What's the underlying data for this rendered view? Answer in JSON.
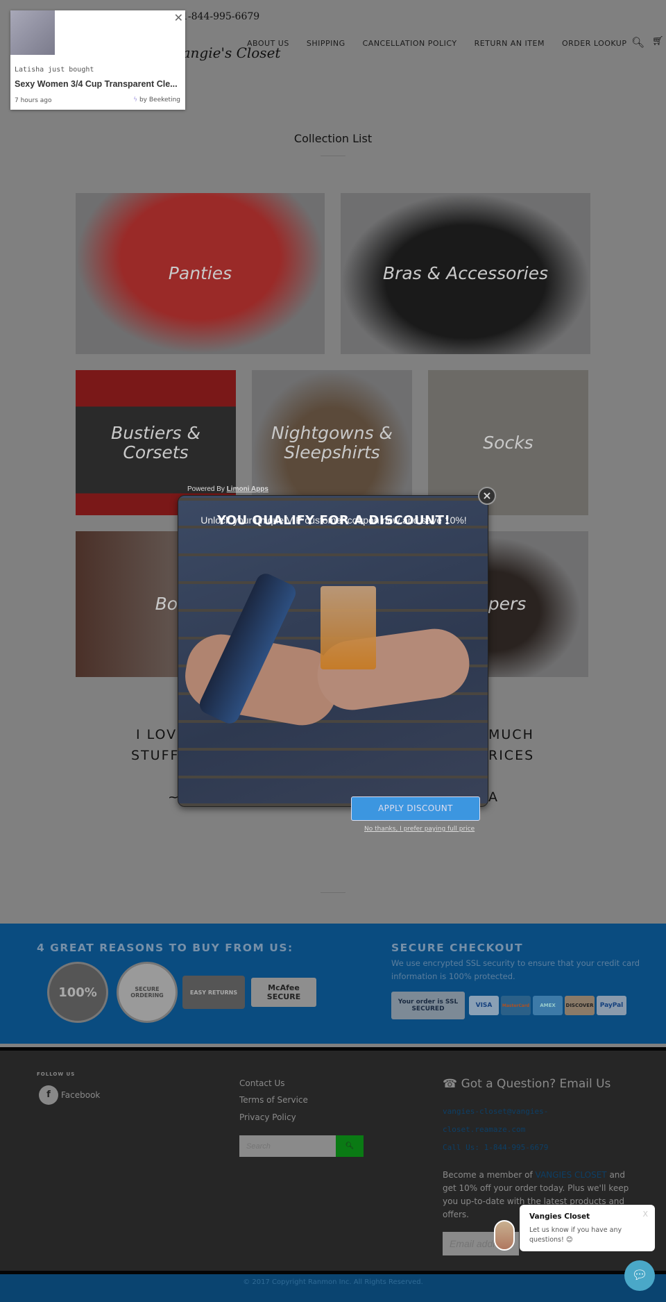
{
  "header": {
    "phone": "1-844-995-6679",
    "logo": "Vangie's Closet",
    "nav": [
      "ABOUT US",
      "SHIPPING",
      "CANCELLATION POLICY",
      "RETURN AN ITEM",
      "ORDER LOOKUP"
    ],
    "icons": [
      "search-icon",
      "cart-icon"
    ]
  },
  "collection": {
    "title": "Collection List",
    "tiles": [
      "Panties",
      "Bras & Accessories",
      "Bustiers & Corsets",
      "Nightgowns & Sleepshirts",
      "Socks",
      "Bodysuits",
      "Rompers"
    ]
  },
  "ticker": {
    "who": "Latisha just bought",
    "product": "Sexy Women 3/4 Cup Transparent Cle...",
    "time": "7 hours ago",
    "by": "by Beeketing"
  },
  "popup": {
    "powered_prefix": "Powered By",
    "powered_link": "Limoni Apps",
    "title": "YOU QUALIFY FOR A DISCOUNT!",
    "subtitle": "Unlock your unique VIP customer coupon now and save 10%!",
    "apply": "APPLY DISCOUNT",
    "no_thanks": "No thanks, I prefer paying full price",
    "close": "×"
  },
  "banner_text": {
    "l1a": "I LOV",
    "l1b": "MUCH",
    "l2a": "STUFF",
    "l2b": "RICES",
    "l3a": "~",
    "l3b": "A"
  },
  "trust": {
    "title": "4 GREAT REASONS TO BUY FROM US:",
    "badges": [
      "100%",
      "SECURE ORDERING",
      "EASY RETURNS",
      "McAfee SECURE"
    ],
    "checkout_title": "SECURE CHECKOUT",
    "checkout_text": "We use encrypted SSL security to ensure that your credit card information is 100% protected.",
    "ssl": "Your order is SSL SECURED",
    "cards": [
      "VISA",
      "MasterCard",
      "AMEX",
      "DISCOVER",
      "PayPal"
    ]
  },
  "footer": {
    "follow": "FOLLOW US",
    "facebook": "Facebook",
    "links": [
      "Contact Us",
      "Terms of Service",
      "Privacy Policy"
    ],
    "search_placeholder": "Search",
    "question": "Got a Question? Email Us",
    "email1": "vangies-closet@vangies-",
    "email2": "closet.reamaze.com",
    "call": "Call Us: 1-844-995-6679",
    "member_pre": "Become a member of",
    "member_brand": "VANGIES CLOSET",
    "member_post": "and get 10% off your order today. Plus we'll keep you up-to-date with the latest products and offers.",
    "email_placeholder": "Email address",
    "copyright": "© 2017 Copyright Ranmon Inc. All Rights Reserved."
  },
  "chat": {
    "name": "Vangies Closet",
    "message": "Let us know if you have any questions! 😊",
    "close": "X"
  },
  "colors": {
    "blue_band": "#0a4c80",
    "footer": "#262626",
    "search_button": "#0a7a14",
    "apply": "#3c96e0"
  }
}
